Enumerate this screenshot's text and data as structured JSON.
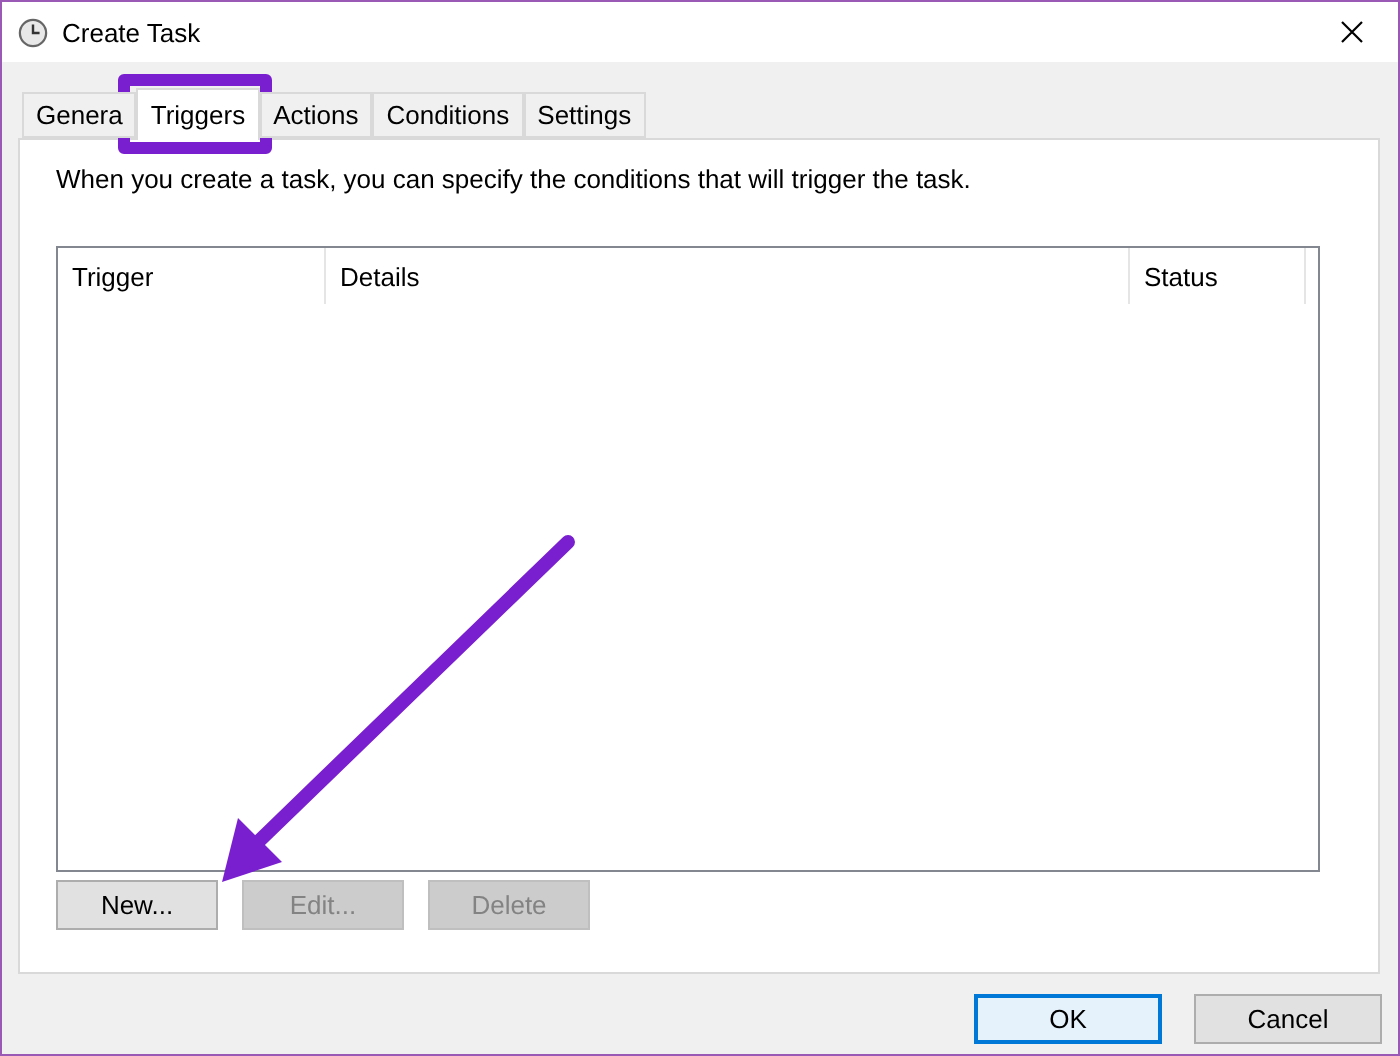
{
  "window": {
    "title": "Create Task"
  },
  "tabs": [
    {
      "label": "Genera",
      "selected": false
    },
    {
      "label": "Triggers",
      "selected": true
    },
    {
      "label": "Actions",
      "selected": false
    },
    {
      "label": "Conditions",
      "selected": false
    },
    {
      "label": "Settings",
      "selected": false
    }
  ],
  "description": "When you create a task, you can specify the conditions that will trigger the task.",
  "table": {
    "columns": [
      "Trigger",
      "Details",
      "Status"
    ]
  },
  "list_buttons": [
    {
      "label": "New...",
      "disabled": false
    },
    {
      "label": "Edit...",
      "disabled": true
    },
    {
      "label": "Delete",
      "disabled": true
    }
  ],
  "dialog_buttons": [
    {
      "label": "OK",
      "default": true
    },
    {
      "label": "Cancel",
      "default": false
    }
  ],
  "annotations": {
    "highlight_frame": true,
    "arrow": true
  }
}
